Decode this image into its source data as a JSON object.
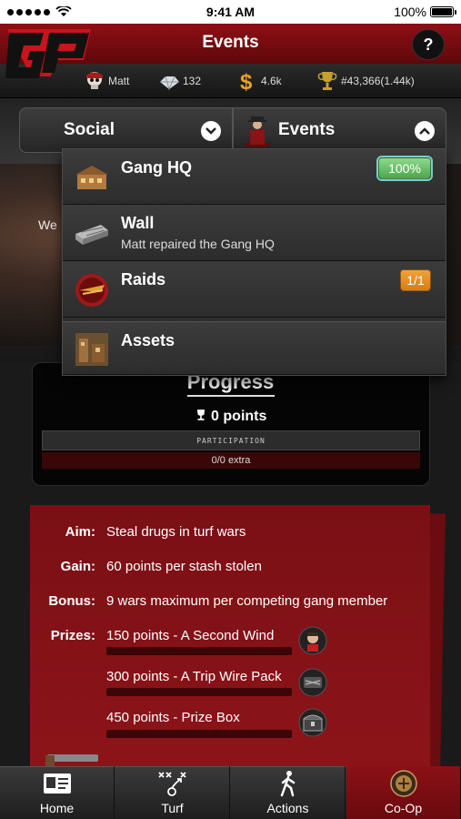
{
  "status_bar": {
    "time": "9:41 AM",
    "battery": "100%"
  },
  "header": {
    "title": "Events",
    "help_label": "?"
  },
  "stats": {
    "player_name": "Matt",
    "diamonds": "132",
    "cash": "4.6k",
    "rank": "#43,366(1.44k)"
  },
  "scene": {
    "partial_text": "We"
  },
  "tabs": {
    "social_label": "Social",
    "events_label": "Events"
  },
  "menu": {
    "items": [
      {
        "title": "Gang HQ",
        "badge": "100%",
        "icon": "building-icon"
      },
      {
        "title": "Wall",
        "subtitle": "Matt repaired the Gang HQ",
        "icon": "wall-icon"
      },
      {
        "title": "Raids",
        "badge": "1/1",
        "icon": "raid-icon"
      },
      {
        "title": "Assets",
        "icon": "assets-icon"
      }
    ]
  },
  "progress": {
    "title": "Progress",
    "points": "0 points",
    "participation_label": "PARTICIPATION",
    "extra": "0/0 extra"
  },
  "info": {
    "aim_label": "Aim:",
    "aim_value": "Steal drugs in turf wars",
    "gain_label": "Gain:",
    "gain_value": "60 points per stash stolen",
    "bonus_label": "Bonus:",
    "bonus_value": "9 wars maximum per competing gang member",
    "prizes_label": "Prizes:",
    "prizes": [
      {
        "text": "150 points - A Second Wind",
        "icon": "second-wind-icon"
      },
      {
        "text": "300 points - A Trip Wire Pack",
        "icon": "trip-wire-icon"
      },
      {
        "text": "450 points - Prize Box",
        "icon": "prize-box-icon"
      }
    ]
  },
  "tabbar": {
    "home": "Home",
    "turf": "Turf",
    "actions": "Actions",
    "coop": "Co-Op"
  },
  "colors": {
    "brand_red": "#8e0f14",
    "badge_green": "#4aa84a",
    "badge_orange": "#d77d12"
  }
}
